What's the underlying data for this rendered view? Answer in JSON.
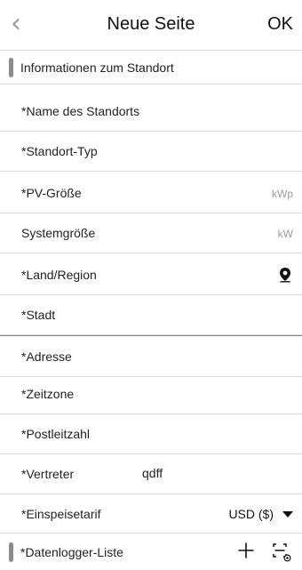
{
  "header": {
    "back_glyph": "‹",
    "title": "Neue Seite",
    "ok_label": "OK"
  },
  "section": {
    "location_info": "Informationen zum Standort"
  },
  "fields": [
    {
      "label": "*Name des Standorts",
      "unit": "",
      "value": ""
    },
    {
      "label": "*Standort-Typ",
      "unit": "",
      "value": ""
    },
    {
      "label": "*PV-Größe",
      "unit": "kWp",
      "value": ""
    },
    {
      "label": "Systemgröße",
      "unit": "kW",
      "value": ""
    },
    {
      "label": "*Land/Region",
      "unit": "",
      "value": ""
    },
    {
      "label": "*Stadt",
      "unit": "",
      "value": ""
    },
    {
      "label": "*Adresse",
      "unit": "",
      "value": ""
    },
    {
      "label": "*Zeitzone",
      "unit": "",
      "value": ""
    },
    {
      "label": "*Postleitzahl",
      "unit": "",
      "value": ""
    },
    {
      "label": "*Vertreter",
      "unit": "",
      "value": "qdff"
    },
    {
      "label": "*Einspeisetarif",
      "unit": "",
      "value": ""
    }
  ],
  "currency": {
    "selected": "USD ($)"
  },
  "datalogger": {
    "label": "*Datenlogger-Liste"
  },
  "icons": {
    "back": "chevron-left-icon",
    "location": "location-pin-icon",
    "add": "plus-icon",
    "scan": "scan-icon"
  }
}
